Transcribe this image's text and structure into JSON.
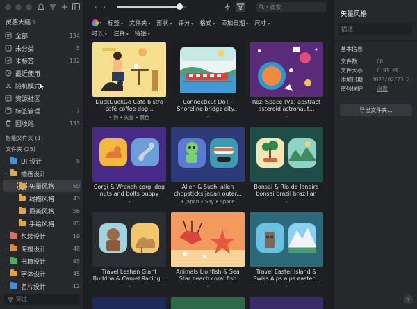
{
  "sidebar": {
    "library_title": "灵感大脑",
    "main_items": [
      {
        "label": "全部",
        "count": "134",
        "icon": "all-icon"
      },
      {
        "label": "未分类",
        "count": "5",
        "icon": "uncategorized-icon"
      },
      {
        "label": "未标签",
        "count": "132",
        "icon": "untagged-icon"
      },
      {
        "label": "最近使用",
        "count": "",
        "icon": "recent-icon"
      },
      {
        "label": "随机模式",
        "count": "",
        "icon": "shuffle-icon"
      },
      {
        "label": "资源社区",
        "count": "",
        "icon": "community-icon"
      },
      {
        "label": "标签管理",
        "count": "7",
        "icon": "tag-icon"
      },
      {
        "label": "回收站",
        "count": "133",
        "icon": "trash-icon"
      }
    ],
    "smart_folders_label": "智能文件夹 (1)",
    "folders_label": "文件夹 (25)",
    "folders": [
      {
        "label": "UI 设计",
        "count": "8",
        "color": "#3e8fe0",
        "level": 0,
        "expanded": false,
        "selected": false
      },
      {
        "label": "插画设计",
        "count": "",
        "color": "#d9a84a",
        "level": 0,
        "expanded": true,
        "selected": false
      },
      {
        "label": "矢量风格",
        "count": "60",
        "color": "#d9a84a",
        "level": 1,
        "expanded": false,
        "selected": true
      },
      {
        "label": "线描风格",
        "count": "43",
        "color": "#d9a84a",
        "level": 1,
        "expanded": false,
        "selected": false
      },
      {
        "label": "原画风格",
        "count": "56",
        "color": "#d9a84a",
        "level": 1,
        "expanded": false,
        "selected": false
      },
      {
        "label": "手绘风格",
        "count": "85",
        "color": "#d9a84a",
        "level": 1,
        "expanded": false,
        "selected": false
      },
      {
        "label": "包装设计",
        "count": "19",
        "color": "#e26a4d",
        "level": 0,
        "expanded": false,
        "selected": false
      },
      {
        "label": "海报设计",
        "count": "48",
        "color": "#e08a3a",
        "level": 0,
        "expanded": false,
        "selected": false
      },
      {
        "label": "书籍设计",
        "count": "95",
        "color": "#4caf50",
        "level": 0,
        "expanded": false,
        "selected": false
      },
      {
        "label": "字体设计",
        "count": "45",
        "color": "#e0a238",
        "level": 0,
        "expanded": false,
        "selected": false
      },
      {
        "label": "名片设计",
        "count": "12",
        "color": "#3e8fe0",
        "level": 0,
        "expanded": false,
        "selected": false
      }
    ],
    "filter_placeholder": "筛选"
  },
  "toolbar": {
    "back": "‹",
    "forward": "›",
    "zoom_fraction": 0.9,
    "search_placeholder": "搜索"
  },
  "filters": {
    "row1": [
      "标签",
      "文件夹",
      "形状",
      "评分",
      "格式",
      "添加日期",
      "尺寸"
    ],
    "row2": [
      "时长",
      "注释",
      "链接"
    ]
  },
  "cards": [
    {
      "title": "DuckDuckGo Cafe bistro café coffee dog...",
      "tags": "• 狗 • 矢量 • 黄色",
      "theme": "cafe"
    },
    {
      "title": "Connecticut DoT - Shoreline bridge city...",
      "tags": "-",
      "theme": "train"
    },
    {
      "title": "Rezi Space (V1) abstract asteroid astronaut...",
      "tags": "-",
      "theme": "space"
    },
    {
      "title": "Corgi & Wrench corgi dog nuts and bolts puppy spo...",
      "tags": "-",
      "theme": "corgi"
    },
    {
      "title": "Alien & Sushi alien chopsticks japan outer...",
      "tags": "• Japan • Soy • Space",
      "theme": "alien"
    },
    {
      "title": "Bonsai & Rio de Janeiro bonsai brazil brazilian city...",
      "tags": "-",
      "theme": "bonsai"
    },
    {
      "title": "Travel Leshan Giant Buddha & Camel Racing...",
      "tags": "-",
      "theme": "buddha"
    },
    {
      "title": "Animals Lionfish & Sea Star beach coral fish lionfish...",
      "tags": "-",
      "theme": "sea"
    },
    {
      "title": "Travel Easter Island & Swiss Alps alps easter...",
      "tags": "-",
      "theme": "easter"
    }
  ],
  "inspector": {
    "folder_name": "矢量风格",
    "description_placeholder": "描述",
    "basic_info_label": "基本信息",
    "props": [
      {
        "key": "文件数",
        "value": "60",
        "link": false
      },
      {
        "key": "文件大小",
        "value": "6.91 MB",
        "link": false
      },
      {
        "key": "添加日期",
        "value": "2023/02/23 2:",
        "link": false
      },
      {
        "key": "密码保护",
        "value": "设置",
        "link": true
      }
    ],
    "export_label": "导出文件夹...",
    "help_label": "?"
  }
}
